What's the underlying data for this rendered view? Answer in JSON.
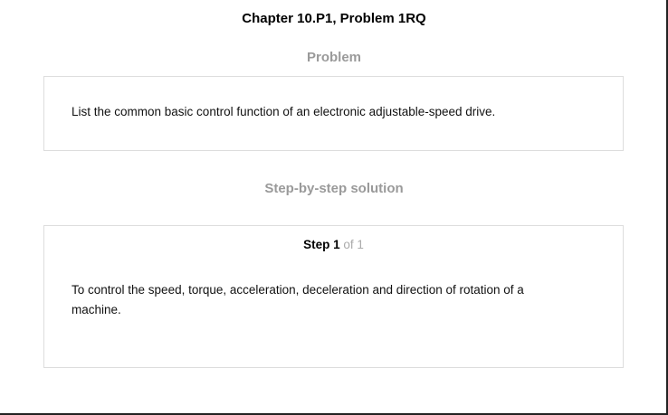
{
  "header": {
    "title": "Chapter 10.P1, Problem 1RQ"
  },
  "problem": {
    "heading": "Problem",
    "text": "List the common basic control function of an electronic adjustable-speed drive."
  },
  "solution": {
    "heading": "Step-by-step solution",
    "step_label": "Step 1",
    "step_of": "of 1",
    "text": "To control the speed, torque, acceleration, deceleration and direction of rotation of a machine."
  }
}
